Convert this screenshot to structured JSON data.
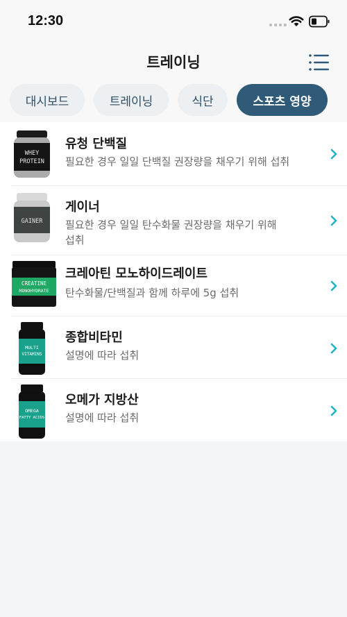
{
  "status_bar": {
    "time": "12:30"
  },
  "header": {
    "title": "트레이닝",
    "menu_icon": "list-menu-icon"
  },
  "tabs": [
    {
      "label": "대시보드",
      "active": false
    },
    {
      "label": "트레이닝",
      "active": false
    },
    {
      "label": "식단",
      "active": false
    },
    {
      "label": "스포츠 영양",
      "active": true
    }
  ],
  "colors": {
    "accent": "#2f5b79",
    "chevron": "#1fb3c6",
    "background": "#f3f5f7"
  },
  "items": [
    {
      "title": "유청 단백질",
      "description": "필요한 경우 일일 단백질 권장량을 채우기 위해 섭취",
      "label_lines": [
        "WHEY",
        "PROTEIN"
      ]
    },
    {
      "title": "게이너",
      "description": "필요한 경우 일일 탄수화물 권장량을 채우기 위해 섭취",
      "label_lines": [
        "GAINER"
      ]
    },
    {
      "title": "크레아틴 모노하이드레이트",
      "description": "탄수화물/단백질과 함께 하루에 5g 섭취",
      "label_lines": [
        "CREATINE",
        "MONOHYDRATE"
      ]
    },
    {
      "title": "종합비타민",
      "description": "설명에 따라 섭취",
      "label_lines": [
        "MULTI",
        "VITAMINS"
      ]
    },
    {
      "title": "오메가 지방산",
      "description": "설명에 따라 섭취",
      "label_lines": [
        "OMEGA",
        "FATTY ACIDS"
      ]
    }
  ]
}
